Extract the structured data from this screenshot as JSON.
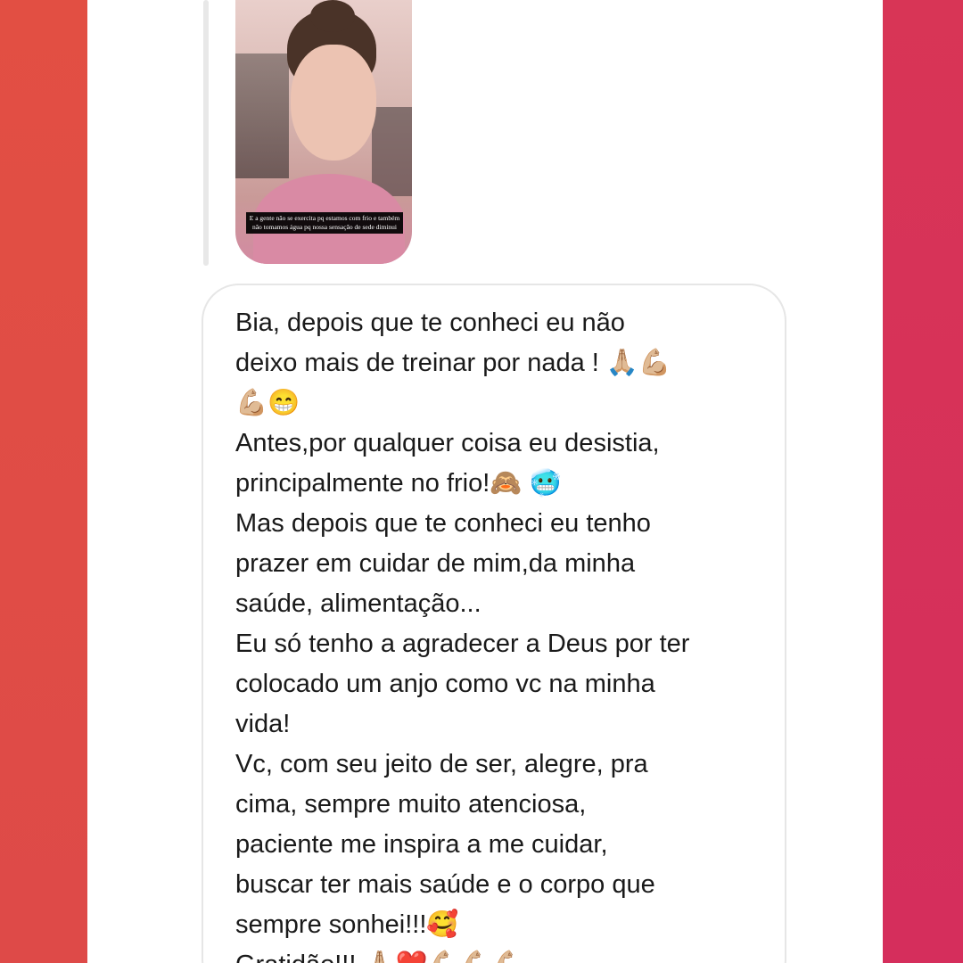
{
  "story_reply": {
    "thumbnail_caption": "E a gente não se exercita pq estamos com frio e também não tomamos água pq nossa sensação de sede diminui",
    "thumbnail_icon": "story-person-thumbnail"
  },
  "message": {
    "lines": [
      "Bia, depois que te conheci eu não",
      "deixo mais de treinar por nada ! 🙏🏼💪🏼",
      "💪🏼😁",
      "Antes,por qualquer coisa eu desistia,",
      "principalmente no frio!🙈 🥶",
      "Mas depois que te conheci eu tenho",
      "prazer em cuidar de mim,da minha",
      "saúde, alimentação...",
      "Eu só tenho a agradecer a Deus por ter",
      "colocado um anjo como vc na minha",
      "vida!",
      "Vc, com seu jeito de ser, alegre, pra",
      "cima, sempre muito atenciosa,",
      "paciente me inspira a me cuidar,",
      "buscar ter mais saúde e o corpo que",
      "sempre sonhei!!!🥰",
      "Gratidão!!! 🙏🏼❤️💪🏼💪🏼💪🏼"
    ]
  },
  "colors": {
    "left_gradient": "#e04e45",
    "right_gradient": "#d6305a",
    "bubble_border": "#e6e6e6",
    "text": "#1a1a1a"
  }
}
